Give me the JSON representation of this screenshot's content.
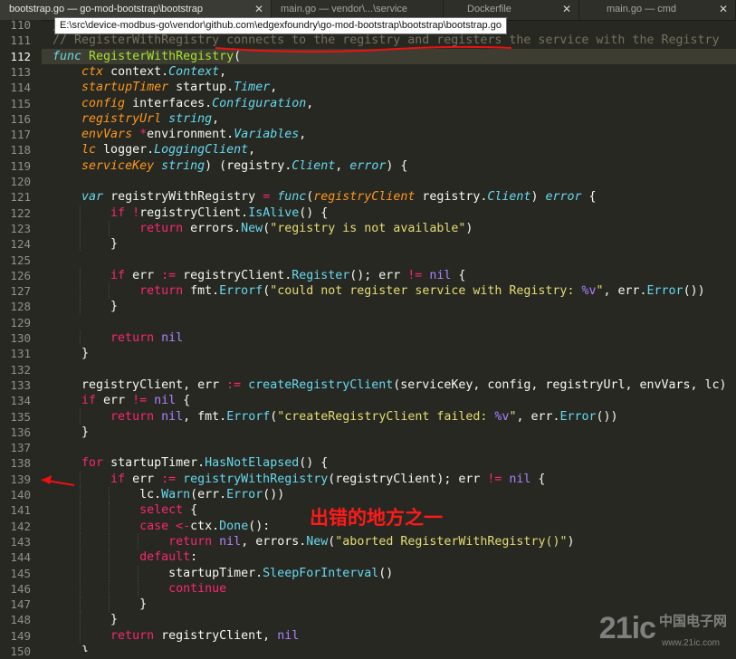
{
  "tabs": [
    {
      "label": "bootstrap.go — go-mod-bootstrap\\bootstrap",
      "active": true
    },
    {
      "label": "main.go — vendor\\...\\service",
      "active": false
    },
    {
      "label": "Dockerfile",
      "active": false
    },
    {
      "label": "main.go — cmd",
      "active": false
    }
  ],
  "tooltip": "E:\\src\\device-modbus-go\\vendor\\github.com\\edgexfoundry\\go-mod-bootstrap\\bootstrap\\bootstrap.go",
  "current_line": "112",
  "lines": [
    {
      "n": "110",
      "t": [
        [
          "}",
          "plain"
        ]
      ]
    },
    {
      "n": "111",
      "t": [
        [
          "// RegisterWithRegistry connects to the registry and registers the service with the Registry",
          "cmt"
        ]
      ]
    },
    {
      "n": "112",
      "t": [
        [
          "func",
          "kw"
        ],
        [
          " ",
          "plain"
        ],
        [
          "RegisterWithRegistry",
          "fn"
        ],
        [
          "(",
          "plain"
        ]
      ]
    },
    {
      "n": "113",
      "t": [
        [
          "    ",
          "plain"
        ],
        [
          "ctx",
          "param"
        ],
        [
          " context.",
          "plain"
        ],
        [
          "Context",
          "type"
        ],
        [
          ",",
          "plain"
        ]
      ]
    },
    {
      "n": "114",
      "t": [
        [
          "    ",
          "plain"
        ],
        [
          "startupTimer",
          "param"
        ],
        [
          " startup.",
          "plain"
        ],
        [
          "Timer",
          "type"
        ],
        [
          ",",
          "plain"
        ]
      ]
    },
    {
      "n": "115",
      "t": [
        [
          "    ",
          "plain"
        ],
        [
          "config",
          "param"
        ],
        [
          " interfaces.",
          "plain"
        ],
        [
          "Configuration",
          "type"
        ],
        [
          ",",
          "plain"
        ]
      ]
    },
    {
      "n": "116",
      "t": [
        [
          "    ",
          "plain"
        ],
        [
          "registryUrl",
          "param"
        ],
        [
          " ",
          "plain"
        ],
        [
          "string",
          "type"
        ],
        [
          ",",
          "plain"
        ]
      ]
    },
    {
      "n": "117",
      "t": [
        [
          "    ",
          "plain"
        ],
        [
          "envVars",
          "param"
        ],
        [
          " ",
          "plain"
        ],
        [
          "*",
          "op"
        ],
        [
          "environment.",
          "plain"
        ],
        [
          "Variables",
          "type"
        ],
        [
          ",",
          "plain"
        ]
      ]
    },
    {
      "n": "118",
      "t": [
        [
          "    ",
          "plain"
        ],
        [
          "lc",
          "param"
        ],
        [
          " logger.",
          "plain"
        ],
        [
          "LoggingClient",
          "type"
        ],
        [
          ",",
          "plain"
        ]
      ]
    },
    {
      "n": "119",
      "t": [
        [
          "    ",
          "plain"
        ],
        [
          "serviceKey",
          "param"
        ],
        [
          " ",
          "plain"
        ],
        [
          "string",
          "type"
        ],
        [
          ") (registry.",
          "plain"
        ],
        [
          "Client",
          "type"
        ],
        [
          ", ",
          "plain"
        ],
        [
          "error",
          "type"
        ],
        [
          ") {",
          "plain"
        ]
      ]
    },
    {
      "n": "120",
      "t": []
    },
    {
      "n": "121",
      "t": [
        [
          "    ",
          "plain"
        ],
        [
          "var",
          "kw"
        ],
        [
          " registryWithRegistry ",
          "plain"
        ],
        [
          "=",
          "op"
        ],
        [
          " ",
          "plain"
        ],
        [
          "func",
          "kw"
        ],
        [
          "(",
          "plain"
        ],
        [
          "registryClient",
          "param"
        ],
        [
          " registry.",
          "plain"
        ],
        [
          "Client",
          "type"
        ],
        [
          ") ",
          "plain"
        ],
        [
          "error",
          "type"
        ],
        [
          " {",
          "plain"
        ]
      ]
    },
    {
      "n": "122",
      "t": [
        [
          "        ",
          "plain"
        ],
        [
          "if",
          "ctl"
        ],
        [
          " ",
          "plain"
        ],
        [
          "!",
          "op"
        ],
        [
          "registryClient.",
          "plain"
        ],
        [
          "IsAlive",
          "meth"
        ],
        [
          "() {",
          "plain"
        ]
      ]
    },
    {
      "n": "123",
      "t": [
        [
          "            ",
          "plain"
        ],
        [
          "return",
          "ctl"
        ],
        [
          " errors.",
          "plain"
        ],
        [
          "New",
          "meth"
        ],
        [
          "(",
          "plain"
        ],
        [
          "\"registry is not available\"",
          "str"
        ],
        [
          ")",
          "plain"
        ]
      ]
    },
    {
      "n": "124",
      "t": [
        [
          "        }",
          "plain"
        ]
      ]
    },
    {
      "n": "125",
      "t": []
    },
    {
      "n": "126",
      "t": [
        [
          "        ",
          "plain"
        ],
        [
          "if",
          "ctl"
        ],
        [
          " err ",
          "plain"
        ],
        [
          ":=",
          "op"
        ],
        [
          " registryClient.",
          "plain"
        ],
        [
          "Register",
          "meth"
        ],
        [
          "(); err ",
          "plain"
        ],
        [
          "!=",
          "op"
        ],
        [
          " ",
          "plain"
        ],
        [
          "nil",
          "num"
        ],
        [
          " {",
          "plain"
        ]
      ]
    },
    {
      "n": "127",
      "t": [
        [
          "            ",
          "plain"
        ],
        [
          "return",
          "ctl"
        ],
        [
          " fmt.",
          "plain"
        ],
        [
          "Errorf",
          "meth"
        ],
        [
          "(",
          "plain"
        ],
        [
          "\"could not register service with Registry: ",
          "str"
        ],
        [
          "%v",
          "num"
        ],
        [
          "\"",
          "str"
        ],
        [
          ", err.",
          "plain"
        ],
        [
          "Error",
          "meth"
        ],
        [
          "())",
          "plain"
        ]
      ]
    },
    {
      "n": "128",
      "t": [
        [
          "        }",
          "plain"
        ]
      ]
    },
    {
      "n": "129",
      "t": []
    },
    {
      "n": "130",
      "t": [
        [
          "        ",
          "plain"
        ],
        [
          "return",
          "ctl"
        ],
        [
          " ",
          "plain"
        ],
        [
          "nil",
          "num"
        ]
      ]
    },
    {
      "n": "131",
      "t": [
        [
          "    }",
          "plain"
        ]
      ]
    },
    {
      "n": "132",
      "t": []
    },
    {
      "n": "133",
      "t": [
        [
          "    registryClient, err ",
          "plain"
        ],
        [
          ":=",
          "op"
        ],
        [
          " ",
          "plain"
        ],
        [
          "createRegistryClient",
          "meth"
        ],
        [
          "(serviceKey, config, registryUrl, envVars, lc)",
          "plain"
        ]
      ]
    },
    {
      "n": "134",
      "t": [
        [
          "    ",
          "plain"
        ],
        [
          "if",
          "ctl"
        ],
        [
          " err ",
          "plain"
        ],
        [
          "!=",
          "op"
        ],
        [
          " ",
          "plain"
        ],
        [
          "nil",
          "num"
        ],
        [
          " {",
          "plain"
        ]
      ]
    },
    {
      "n": "135",
      "t": [
        [
          "        ",
          "plain"
        ],
        [
          "return",
          "ctl"
        ],
        [
          " ",
          "plain"
        ],
        [
          "nil",
          "num"
        ],
        [
          ", fmt.",
          "plain"
        ],
        [
          "Errorf",
          "meth"
        ],
        [
          "(",
          "plain"
        ],
        [
          "\"createRegistryClient failed: ",
          "str"
        ],
        [
          "%v",
          "num"
        ],
        [
          "\"",
          "str"
        ],
        [
          ", err.",
          "plain"
        ],
        [
          "Error",
          "meth"
        ],
        [
          "())",
          "plain"
        ]
      ]
    },
    {
      "n": "136",
      "t": [
        [
          "    }",
          "plain"
        ]
      ]
    },
    {
      "n": "137",
      "t": []
    },
    {
      "n": "138",
      "t": [
        [
          "    ",
          "plain"
        ],
        [
          "for",
          "ctl"
        ],
        [
          " startupTimer.",
          "plain"
        ],
        [
          "HasNotElapsed",
          "meth"
        ],
        [
          "() {",
          "plain"
        ]
      ]
    },
    {
      "n": "139",
      "t": [
        [
          "        ",
          "plain"
        ],
        [
          "if",
          "ctl"
        ],
        [
          " err ",
          "plain"
        ],
        [
          ":=",
          "op"
        ],
        [
          " ",
          "plain"
        ],
        [
          "registryWithRegistry",
          "meth"
        ],
        [
          "(registryClient); err ",
          "plain"
        ],
        [
          "!=",
          "op"
        ],
        [
          " ",
          "plain"
        ],
        [
          "nil",
          "num"
        ],
        [
          " {",
          "plain"
        ]
      ]
    },
    {
      "n": "140",
      "t": [
        [
          "            lc.",
          "plain"
        ],
        [
          "Warn",
          "meth"
        ],
        [
          "(err.",
          "plain"
        ],
        [
          "Error",
          "meth"
        ],
        [
          "())",
          "plain"
        ]
      ]
    },
    {
      "n": "141",
      "t": [
        [
          "            ",
          "plain"
        ],
        [
          "select",
          "ctl"
        ],
        [
          " {",
          "plain"
        ]
      ]
    },
    {
      "n": "142",
      "t": [
        [
          "            ",
          "plain"
        ],
        [
          "case",
          "ctl"
        ],
        [
          " ",
          "plain"
        ],
        [
          "<-",
          "op"
        ],
        [
          "ctx.",
          "plain"
        ],
        [
          "Done",
          "meth"
        ],
        [
          "():",
          "plain"
        ]
      ]
    },
    {
      "n": "143",
      "t": [
        [
          "                ",
          "plain"
        ],
        [
          "return",
          "ctl"
        ],
        [
          " ",
          "plain"
        ],
        [
          "nil",
          "num"
        ],
        [
          ", errors.",
          "plain"
        ],
        [
          "New",
          "meth"
        ],
        [
          "(",
          "plain"
        ],
        [
          "\"aborted RegisterWithRegistry()\"",
          "str"
        ],
        [
          ")",
          "plain"
        ]
      ]
    },
    {
      "n": "144",
      "t": [
        [
          "            ",
          "plain"
        ],
        [
          "default",
          "ctl"
        ],
        [
          ":",
          "plain"
        ]
      ]
    },
    {
      "n": "145",
      "t": [
        [
          "                startupTimer.",
          "plain"
        ],
        [
          "SleepForInterval",
          "meth"
        ],
        [
          "()",
          "plain"
        ]
      ]
    },
    {
      "n": "146",
      "t": [
        [
          "                ",
          "plain"
        ],
        [
          "continue",
          "ctl"
        ]
      ]
    },
    {
      "n": "147",
      "t": [
        [
          "            }",
          "plain"
        ]
      ]
    },
    {
      "n": "148",
      "t": [
        [
          "        }",
          "plain"
        ]
      ]
    },
    {
      "n": "149",
      "t": [
        [
          "        ",
          "plain"
        ],
        [
          "return",
          "ctl"
        ],
        [
          " registryClient, ",
          "plain"
        ],
        [
          "nil",
          "num"
        ]
      ]
    },
    {
      "n": "150",
      "t": [
        [
          "    }",
          "plain"
        ]
      ]
    }
  ],
  "annotation": "出错的地方之一",
  "watermark": {
    "logo": "21ic",
    "sub": "中国电子网",
    "url": "www.21ic.com"
  },
  "colors": {
    "background": "#272822",
    "comment": "#75715e",
    "keyword": "#66d9ef",
    "control": "#f92672",
    "function": "#a6e22e",
    "parameter": "#fd971f",
    "string": "#e6db74",
    "constant": "#ae81ff",
    "annotation": "#ff1a1a"
  }
}
